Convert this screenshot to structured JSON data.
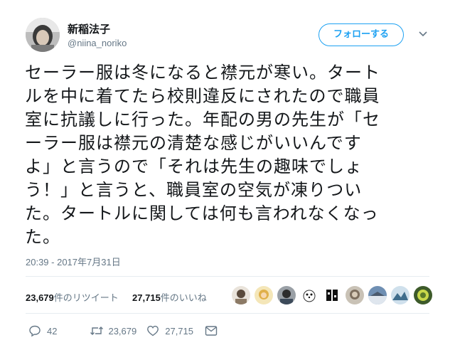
{
  "user": {
    "display_name": "新稲法子",
    "handle": "@niina_noriko",
    "avatar_icon": "avatar-photo"
  },
  "follow_button": {
    "label": "フォローする",
    "color": "#1da1f2"
  },
  "tweet": {
    "lines": [
      "セーラー服は冬になると襟元が寒い。タート",
      "ルを中に着てたら校則違反にされたので職員",
      "室に抗議しに行った。年配の男の先生が「セ",
      "ーラー服は襟元の清楚な感じがいいんです",
      "よ」と言うので「それは先生の趣味でしょ",
      "う！」と言うと、職員室の空気が凍りつい",
      "た。タートルに関しては何も言われなくなっ",
      "た。"
    ],
    "timestamp": "20:39 - 2017年7月31日"
  },
  "stats": {
    "retweets_count": "23,679",
    "retweets_label": "件のリツイート",
    "likes_count": "27,715",
    "likes_label": "件のいいね"
  },
  "liker_avatars": [
    "avatar-1",
    "avatar-2",
    "avatar-3",
    "avatar-4",
    "avatar-5",
    "avatar-6",
    "avatar-7",
    "avatar-8",
    "avatar-9"
  ],
  "actions": {
    "reply_count": "42",
    "retweet_count": "23,679",
    "like_count": "27,715",
    "icons": [
      "reply-icon",
      "retweet-icon",
      "like-icon",
      "message-icon"
    ]
  }
}
